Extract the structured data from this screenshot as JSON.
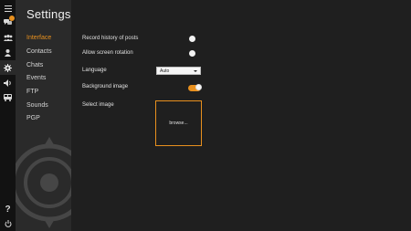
{
  "app": {
    "title": "Settings"
  },
  "rail": {
    "items": [
      {
        "icon": "hamburger-menu-icon"
      },
      {
        "icon": "chat-bubbles-icon",
        "has_badge": true
      },
      {
        "icon": "group-icon"
      },
      {
        "icon": "person-icon"
      },
      {
        "icon": "gear-icon",
        "active": true
      },
      {
        "icon": "speaker-icon"
      },
      {
        "icon": "bus-icon"
      },
      {
        "icon": "help-icon"
      },
      {
        "icon": "power-icon"
      }
    ],
    "help_label": "?"
  },
  "nav": {
    "items": [
      {
        "label": "Interface",
        "active": true
      },
      {
        "label": "Contacts"
      },
      {
        "label": "Chats"
      },
      {
        "label": "Events"
      },
      {
        "label": "FTP"
      },
      {
        "label": "Sounds"
      },
      {
        "label": "PGP"
      }
    ]
  },
  "interface": {
    "record_history_label": "Record history of posts",
    "screen_rotation_label": "Allow screen rotation",
    "language_label": "Language",
    "language_value": "Auto",
    "background_image_label": "Background image",
    "background_image_enabled": true,
    "select_image_label": "Select image",
    "browse_label": "browse..."
  },
  "colors": {
    "accent": "#e8901e",
    "rail_bg": "#121212",
    "nav_bg": "#2a2a2a",
    "content_bg": "#1f1f1f"
  }
}
